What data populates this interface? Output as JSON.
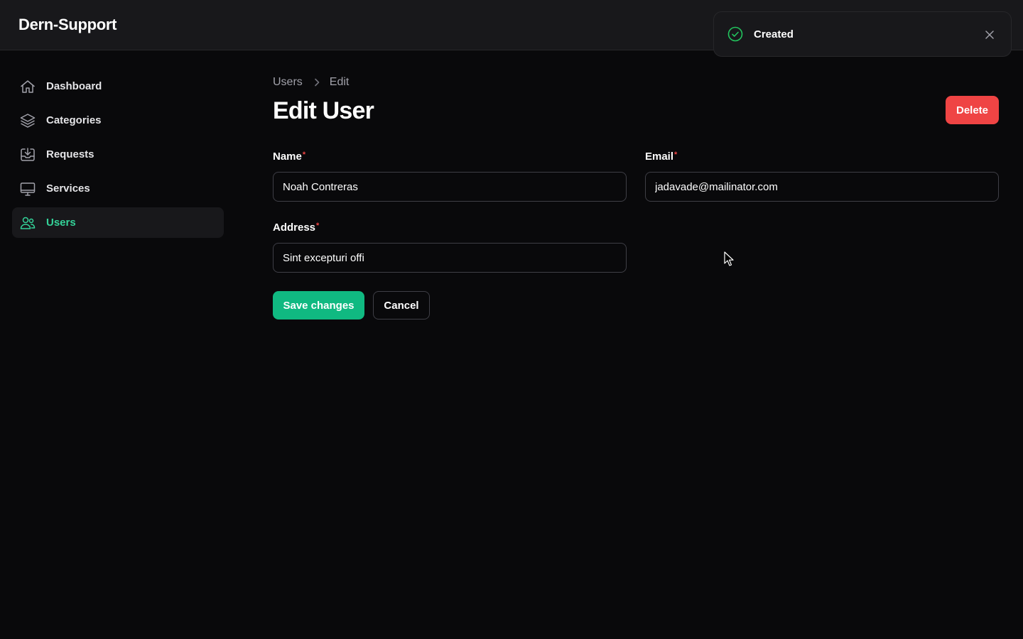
{
  "app": {
    "title": "Dern-Support"
  },
  "sidebar": {
    "items": [
      {
        "label": "Dashboard",
        "icon": "home-icon",
        "active": false
      },
      {
        "label": "Categories",
        "icon": "layers-icon",
        "active": false
      },
      {
        "label": "Requests",
        "icon": "inbox-download-icon",
        "active": false
      },
      {
        "label": "Services",
        "icon": "monitor-icon",
        "active": false
      },
      {
        "label": "Users",
        "icon": "users-icon",
        "active": true
      }
    ]
  },
  "breadcrumb": {
    "parent": "Users",
    "current": "Edit"
  },
  "page": {
    "title": "Edit User",
    "delete_label": "Delete"
  },
  "form": {
    "name": {
      "label": "Name",
      "required_mark": "*",
      "value": "Noah Contreras"
    },
    "email": {
      "label": "Email",
      "required_mark": "*",
      "value": "jadavade@mailinator.com"
    },
    "address": {
      "label": "Address",
      "required_mark": "*",
      "value": "Sint excepturi offi"
    },
    "save_label": "Save changes",
    "cancel_label": "Cancel"
  },
  "toast": {
    "message": "Created",
    "status": "success"
  },
  "colors": {
    "accent": "#10b981",
    "accent_text": "#34d399",
    "danger": "#ef4444",
    "background": "#09090b",
    "surface": "#18181b"
  }
}
